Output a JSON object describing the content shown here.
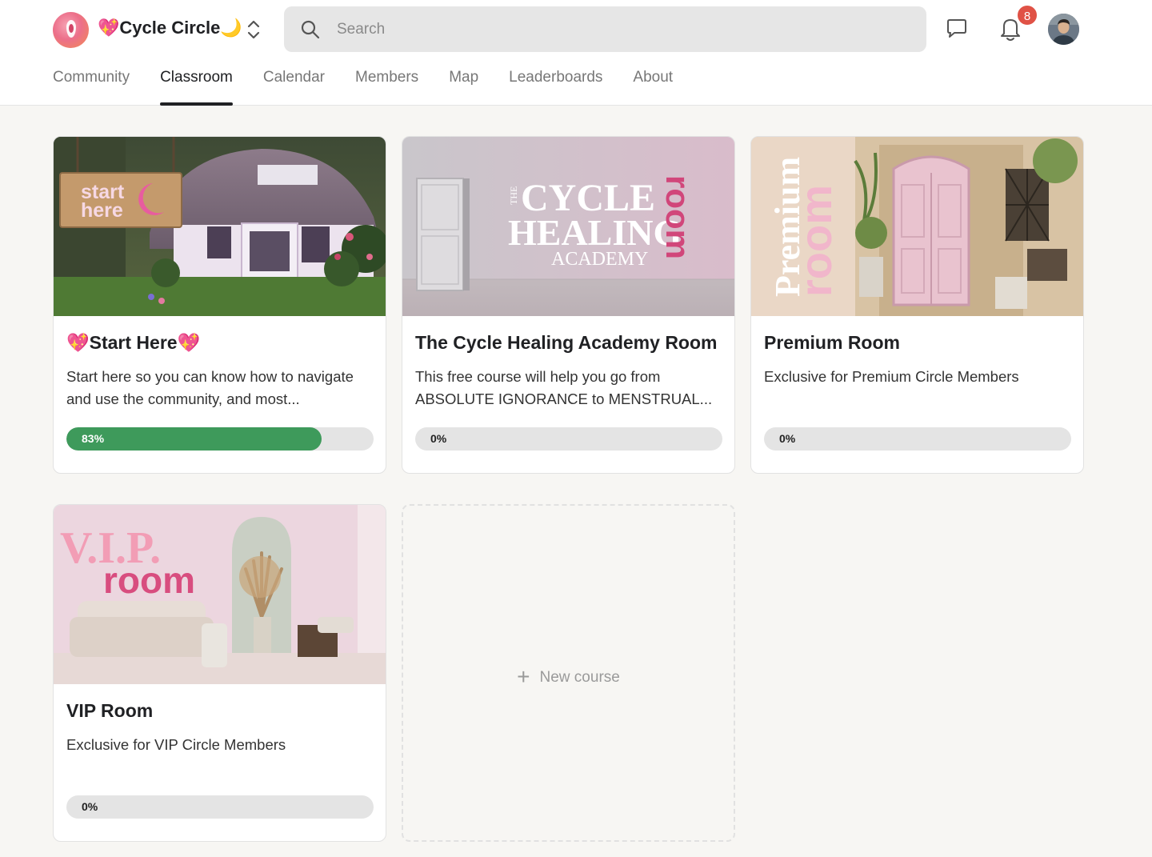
{
  "app": {
    "name": "Cycle Circle",
    "name_prefix_icon": "💖",
    "name_suffix_icon": "🌙"
  },
  "search": {
    "placeholder": "Search",
    "value": ""
  },
  "notifications": {
    "count": "8"
  },
  "nav": {
    "tabs": [
      {
        "label": "Community",
        "active": false
      },
      {
        "label": "Classroom",
        "active": true
      },
      {
        "label": "Calendar",
        "active": false
      },
      {
        "label": "Members",
        "active": false
      },
      {
        "label": "Map",
        "active": false
      },
      {
        "label": "Leaderboards",
        "active": false
      },
      {
        "label": "About",
        "active": false
      }
    ]
  },
  "courses": [
    {
      "title": "💖Start Here💖",
      "description": "Start here so you can know how to navigate and use the community, and most...",
      "progress": 0.83,
      "progress_label": "83%",
      "thumb_text": [
        "start",
        "here"
      ]
    },
    {
      "title": "The Cycle Healing Academy Room",
      "description": "This free course will help you go from ABSOLUTE IGNORANCE to MENSTRUAL...",
      "progress": 0,
      "progress_label": "0%",
      "thumb_text": [
        "THE",
        "CYCLE",
        "HEALING",
        "ACADEMY",
        "room"
      ]
    },
    {
      "title": "Premium Room",
      "description": "Exclusive for Premium Circle Members",
      "progress": 0,
      "progress_label": "0%",
      "thumb_text": [
        "Premium",
        "room"
      ]
    },
    {
      "title": "VIP Room",
      "description": "Exclusive for VIP Circle Members",
      "progress": 0,
      "progress_label": "0%",
      "thumb_text": [
        "V.I.P.",
        "room"
      ]
    }
  ],
  "new_course": {
    "label": "New course"
  },
  "colors": {
    "accent": "#202124",
    "progress_fill": "#3e9a5b",
    "progress_track": "#e4e4e4",
    "badge": "#e05246",
    "pink": "#ec6f8a"
  },
  "icons": {
    "search": "search-icon",
    "chat": "chat-icon",
    "bell": "bell-icon",
    "switcher": "chevron-up-down-icon",
    "plus": "plus-icon"
  }
}
